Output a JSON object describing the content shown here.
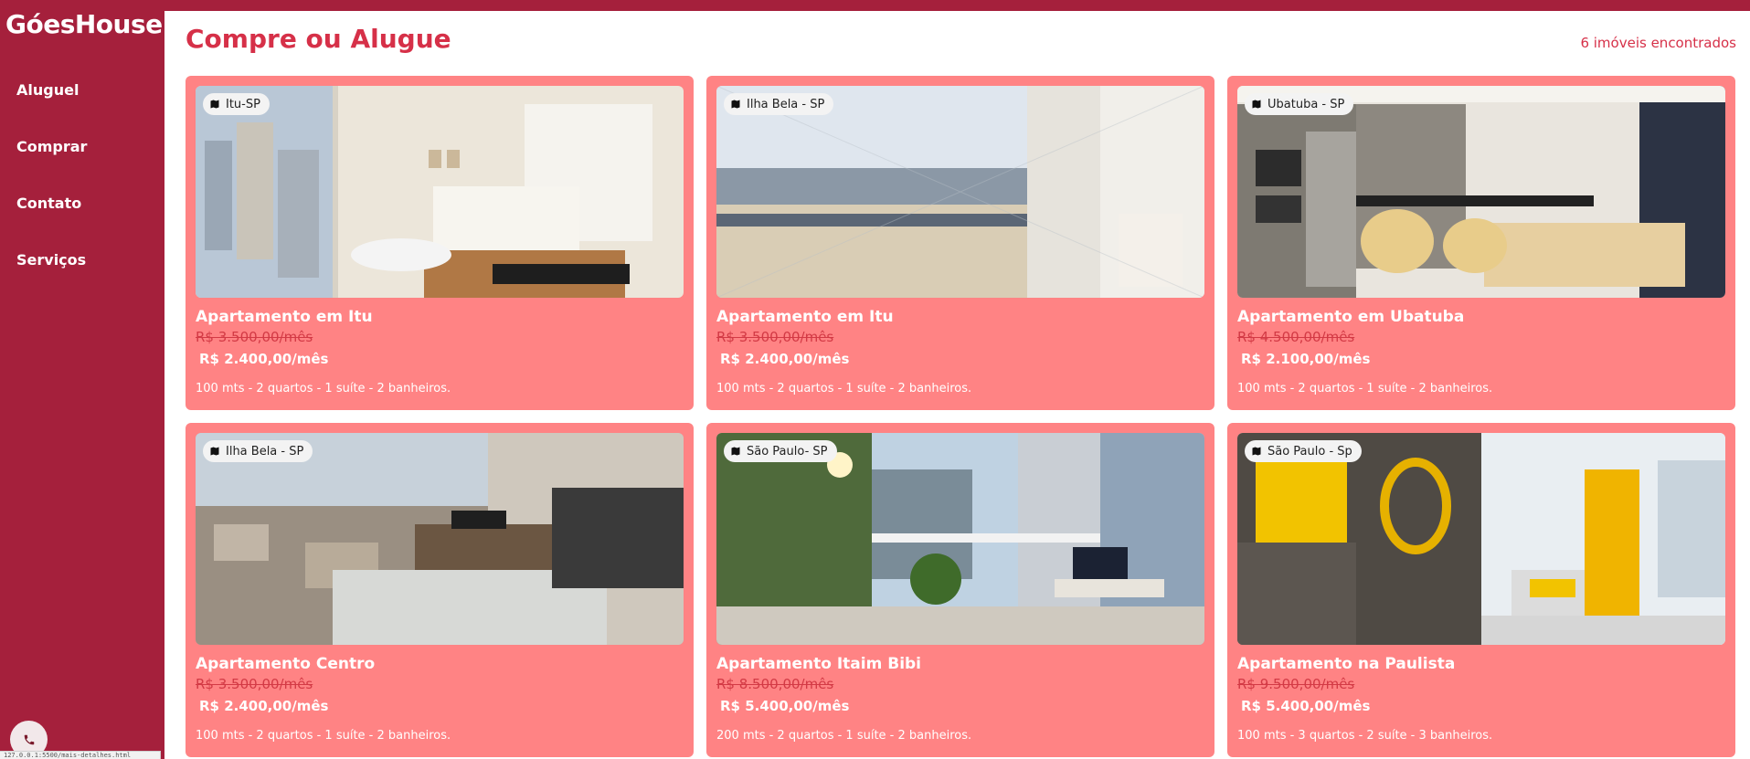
{
  "brand": "GóesHouse",
  "nav": [
    "Aluguel",
    "Comprar",
    "Contato",
    "Serviços"
  ],
  "header": {
    "title": "Compre ou Alugue",
    "count": "6 imóveis encontrados"
  },
  "status_bar": {
    "text": "127.0.0.1:5500/mais-detalhes.html"
  },
  "listings": [
    {
      "location": "Itu-SP",
      "title": "Apartamento em Itu",
      "old_price": "R$ 3.500,00/mês",
      "price": "R$ 2.400,00/mês",
      "details": "100 mts - 2 quartos - 1 suíte - 2 banheiros."
    },
    {
      "location": "Ilha Bela - SP",
      "title": "Apartamento em Itu",
      "old_price": "R$ 3.500,00/mês",
      "price": "R$ 2.400,00/mês",
      "details": "100 mts - 2 quartos - 1 suíte - 2 banheiros."
    },
    {
      "location": "Ubatuba - SP",
      "title": "Apartamento em Ubatuba",
      "old_price": "R$ 4.500,00/mês",
      "price": "R$ 2.100,00/mês",
      "details": "100 mts - 2 quartos - 1 suíte - 2 banheiros."
    },
    {
      "location": "Ilha Bela - SP",
      "title": "Apartamento Centro",
      "old_price": "R$ 3.500,00/mês",
      "price": "R$ 2.400,00/mês",
      "details": "100 mts - 2 quartos - 1 suíte - 2 banheiros."
    },
    {
      "location": "São Paulo- SP",
      "title": "Apartamento Itaim Bibi",
      "old_price": "R$ 8.500,00/mês",
      "price": "R$ 5.400,00/mês",
      "details": "200 mts - 2 quartos - 1 suíte - 2 banheiros."
    },
    {
      "location": "São Paulo - Sp",
      "title": "Apartamento na Paulista",
      "old_price": "R$ 9.500,00/mês",
      "price": "R$ 5.400,00/mês",
      "details": "100 mts - 3 quartos - 2 suíte - 3 banheiros."
    }
  ],
  "colors": {
    "sidebar": "#a5203c",
    "card": "#ff8384",
    "accent": "#d63048"
  },
  "icons": {
    "location": "map-icon",
    "phone": "phone-icon"
  }
}
